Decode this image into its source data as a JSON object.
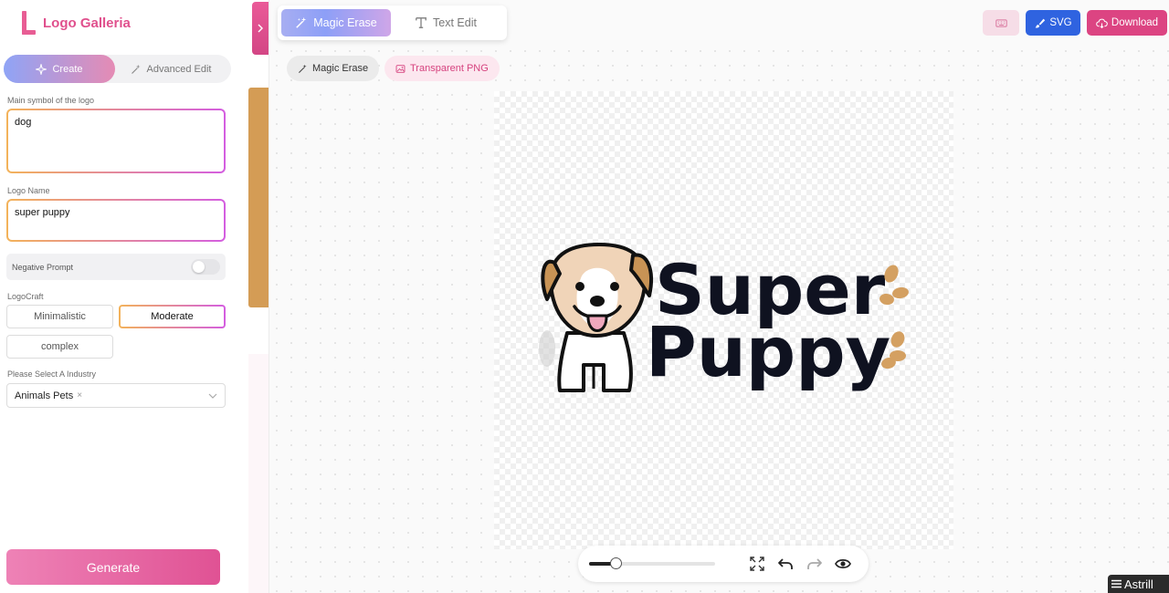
{
  "app": {
    "name": "Logo Galleria"
  },
  "sidebar": {
    "modes": [
      {
        "label": "Create",
        "active": true
      },
      {
        "label": "Advanced Edit",
        "active": false
      }
    ],
    "symbol": {
      "label": "Main symbol of the logo",
      "value": "dog"
    },
    "name": {
      "label": "Logo Name",
      "value": "super puppy"
    },
    "negative_prompt": {
      "label": "Negative Prompt",
      "enabled": false
    },
    "logocraft": {
      "label": "LogoCraft",
      "options": [
        "Minimalistic",
        "Moderate",
        "complex"
      ],
      "selected": "Moderate"
    },
    "industry": {
      "label": "Please Select A Industry",
      "value": "Animals Pets",
      "remove": "×"
    },
    "generate_label": "Generate"
  },
  "toolbar": {
    "tools": [
      {
        "label": "Magic Erase",
        "active": true
      },
      {
        "label": "Text Edit",
        "active": false
      }
    ],
    "svg_label": "SVG",
    "download_label": "Download"
  },
  "chips": {
    "erase": "Magic Erase",
    "png": "Transparent PNG"
  },
  "logo_preview": {
    "line1": "Super",
    "line2": "Puppy"
  },
  "zoom": {
    "level": 0.2
  },
  "astrill_label": "Astrill",
  "colors": {
    "accent_pink": "#dc4482",
    "svg_blue": "#2f63e0",
    "gradient_start": "#8fa4f6",
    "brand": "#e0508d"
  }
}
